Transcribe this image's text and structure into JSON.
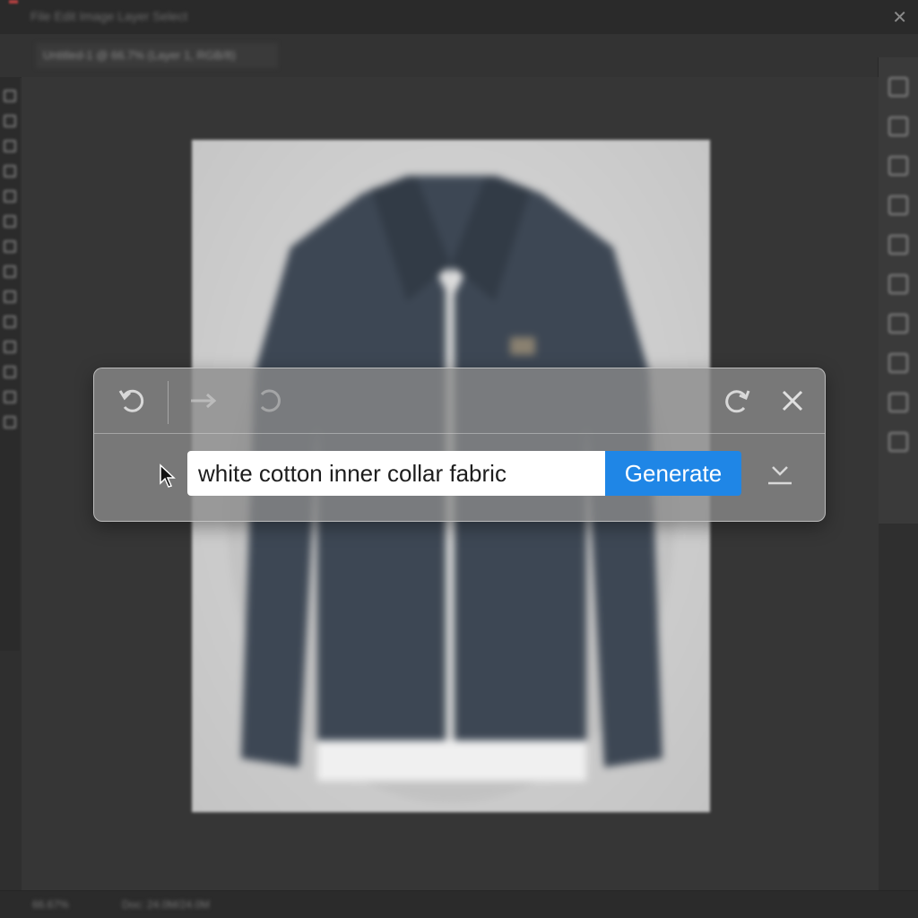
{
  "menubar": {
    "menu_text": "File Edit Image Layer Select",
    "close_glyph": "✕",
    "close_icon": "close-icon"
  },
  "optionsbar": {
    "doc_tab": "Untitled-1 @ 66.7% (Layer 1, RGB/8)"
  },
  "toolbar": {
    "icons": [
      "move-icon",
      "marquee-icon",
      "lasso-icon",
      "crop-icon",
      "eyedropper-icon",
      "brush-icon",
      "clone-icon",
      "eraser-icon",
      "gradient-icon",
      "pen-icon",
      "type-icon",
      "shape-icon",
      "hand-icon",
      "zoom-icon"
    ]
  },
  "right_panel": {
    "icons": [
      "adjust-icon",
      "brush-icon",
      "layers-icon",
      "history-icon",
      "pen-icon",
      "swatches-icon",
      "properties-icon",
      "channels-icon",
      "paths-icon",
      "libraries-icon"
    ]
  },
  "statusbar": {
    "zoom": "66.67%",
    "doc_info": "Doc: 24.0M/24.0M"
  },
  "generative_panel": {
    "prompt_value": "white cotton inner collar fabric",
    "generate_label": "Generate",
    "icons": {
      "undo": "undo-icon",
      "redo": "redo-arrow-icon",
      "redo_alt": "redo-icon",
      "refresh": "refresh-icon",
      "close": "close-icon",
      "dropdown": "chevron-down-icon",
      "cursor": "mouse-cursor-icon"
    }
  },
  "colors": {
    "accent": "#1f86e6",
    "canvas_bg": "#cdcdcd",
    "jacket": "#3d4754",
    "app_bg": "#2f2f2f"
  }
}
